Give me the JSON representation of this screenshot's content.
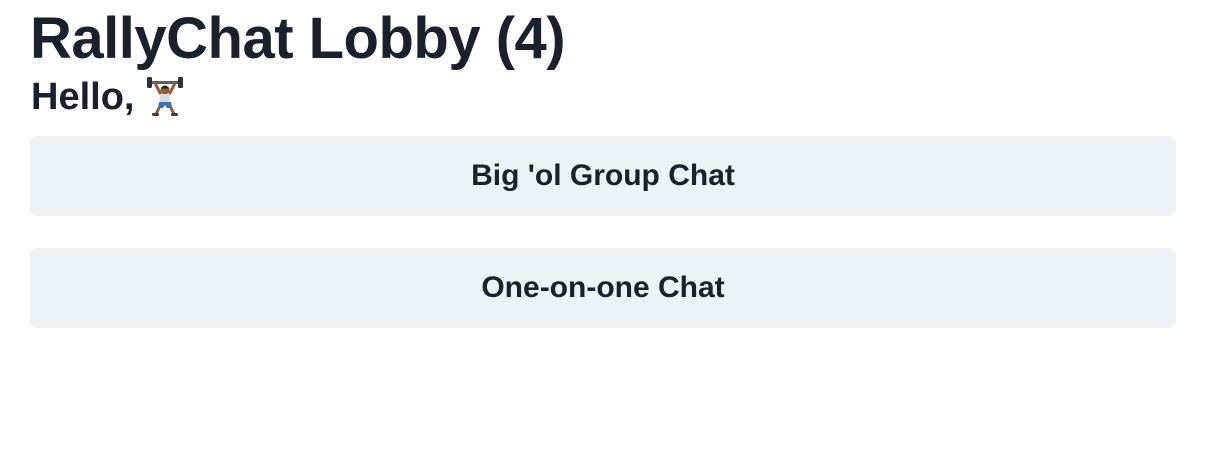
{
  "lobby": {
    "title": "RallyChat Lobby (4)",
    "greeting": "Hello,",
    "user_avatar_icon": "weightlifter-icon"
  },
  "buttons": {
    "group_chat_label": "Big 'ol Group Chat",
    "one_on_one_label": "One-on-one Chat"
  },
  "colors": {
    "text": "#1a202c",
    "button_bg": "#edf2f7",
    "background": "#ffffff"
  }
}
